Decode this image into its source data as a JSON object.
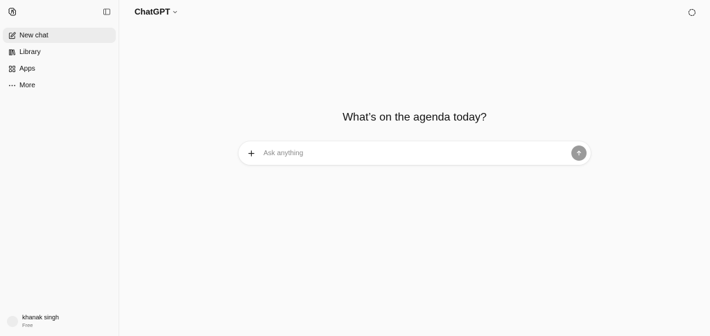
{
  "sidebar": {
    "items": [
      {
        "label": "New chat",
        "icon": "compose-icon"
      },
      {
        "label": "Library",
        "icon": "library-icon"
      },
      {
        "label": "Apps",
        "icon": "apps-icon"
      },
      {
        "label": "More",
        "icon": "more-icon"
      }
    ],
    "user": {
      "name": "khanak singh",
      "plan": "Free"
    }
  },
  "header": {
    "model": "ChatGPT"
  },
  "main": {
    "headline": "What’s on the agenda today?",
    "composer": {
      "placeholder": "Ask anything"
    }
  }
}
